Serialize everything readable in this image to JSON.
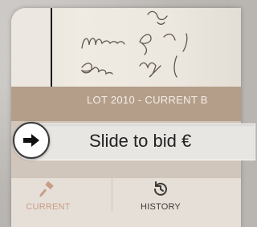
{
  "lot_banner": {
    "text": "LOT 2010 - CURRENT B"
  },
  "slider": {
    "label": "Slide to bid €",
    "knob_icon": "arrow-right-icon"
  },
  "tabs": [
    {
      "label": "CURRENT",
      "icon": "gavel-icon",
      "active": true
    },
    {
      "label": "HISTORY",
      "icon": "history-icon",
      "active": false
    }
  ],
  "colors": {
    "banner": "#b49e89",
    "panel": "#d1c6bb",
    "active_tab": "#c89d87",
    "inactive_tab": "#3d3a36"
  }
}
